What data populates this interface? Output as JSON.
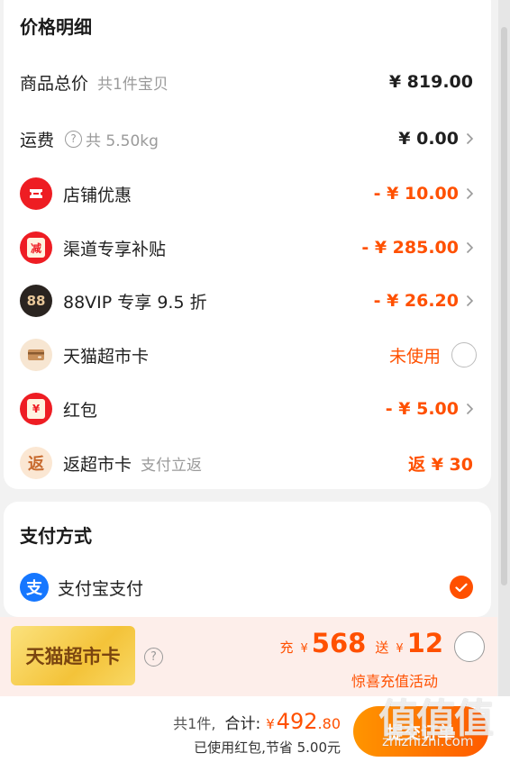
{
  "price_detail": {
    "title": "价格明细",
    "rows": [
      {
        "label": "商品总价",
        "sub": "共1件宝贝",
        "amount": "¥ 819.00"
      },
      {
        "label": "运费",
        "sub": "共 5.50kg",
        "amount": "¥ 0.00"
      },
      {
        "label": "店铺优惠",
        "amount": "- ¥ 10.00"
      },
      {
        "label": "渠道专享补贴",
        "icon_text": "减",
        "amount": "- ¥ 285.00"
      },
      {
        "label": "88VIP 专享 9.5 折",
        "icon_text": "88",
        "amount": "- ¥ 26.20"
      },
      {
        "label": "天猫超市卡",
        "amount": "未使用"
      },
      {
        "label": "红包",
        "icon_text": "¥",
        "amount": "- ¥ 5.00"
      },
      {
        "label": "返超市卡",
        "icon_text": "返",
        "sub": "支付立返",
        "amount": "返 ¥ 30"
      }
    ]
  },
  "payment": {
    "title": "支付方式",
    "method": "支付宝支付",
    "logo_text": "支"
  },
  "promo": {
    "card_label": "天猫超市卡",
    "charge_label": "充",
    "charge_currency": "¥",
    "charge_amount": "568",
    "gift_label": "送",
    "gift_currency": "¥",
    "gift_amount": "12",
    "activity": "惊喜充值活动"
  },
  "footer": {
    "count": "共1件,",
    "total_label": "合计:",
    "currency": "¥",
    "total_int": "492",
    "total_dec": ".80",
    "saved": "已使用红包,节省 5.00元",
    "submit": "提交订单"
  },
  "watermark": {
    "glyphs": "值值值",
    "url": "zhizhizhi.com"
  },
  "colors": {
    "accent": "#ff5000",
    "alipay": "#1677ff",
    "red_icon": "#ee1d23"
  }
}
